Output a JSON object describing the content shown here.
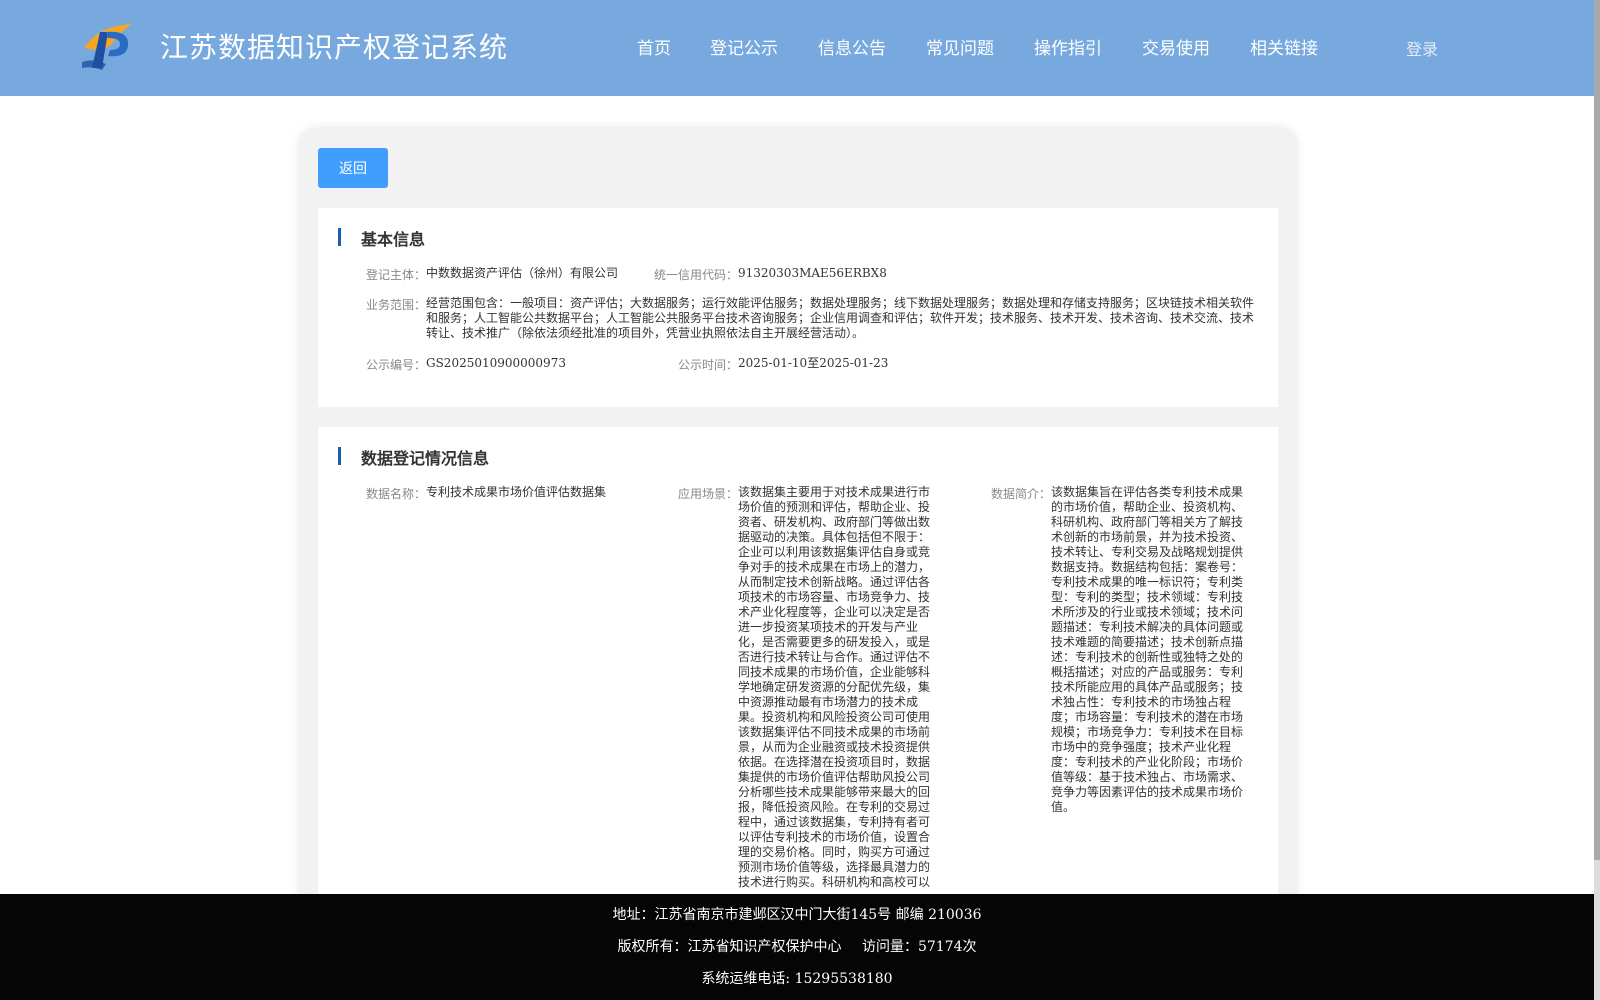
{
  "header": {
    "site_title": "江苏数据知识产权登记系统",
    "nav": [
      "首页",
      "登记公示",
      "信息公告",
      "常见问题",
      "操作指引",
      "交易使用",
      "相关链接"
    ],
    "login_label": "登录",
    "colors": {
      "header_bg": "#78a9de",
      "accent": "#409eff",
      "section_bar": "#1b5ea8"
    }
  },
  "back_label": "返回",
  "basic_info": {
    "title": "基本信息",
    "subject_label": "登记主体：",
    "subject_value": "中数数据资产评估（徐州）有限公司",
    "credit_label": "统一信用代码：",
    "credit_value": "91320303MAE56ERBX8",
    "scope_label": "业务范围：",
    "scope_value": "经营范围包含：一般项目：资产评估；大数据服务；运行效能评估服务；数据处理服务；线下数据处理服务；数据处理和存储支持服务；区块链技术相关软件和服务；人工智能公共数据平台；人工智能公共服务平台技术咨询服务；企业信用调查和评估；软件开发；技术服务、技术开发、技术咨询、技术交流、技术转让、技术推广（除依法须经批准的项目外，凭营业执照依法自主开展经营活动）。",
    "notice_no_label": "公示编号：",
    "notice_no_value": "GS2025010900000973",
    "notice_time_label": "公示时间：",
    "notice_time_value": "2025-01-10至2025-01-23"
  },
  "data_info": {
    "title": "数据登记情况信息",
    "name_label": "数据名称：",
    "name_value": "专利技术成果市场价值评估数据集",
    "scenario_label": "应用场景：",
    "scenario_value": "该数据集主要用于对技术成果进行市场价值的预测和评估，帮助企业、投资者、研发机构、政府部门等做出数据驱动的决策。具体包括但不限于：企业可以利用该数据集评估自身或竞争对手的技术成果在市场上的潜力，从而制定技术创新战略。通过评估各项技术的市场容量、市场竞争力、技术产业化程度等，企业可以决定是否进一步投资某项技术的开发与产业化，是否需要更多的研发投入，或是否进行技术转让与合作。通过评估不同技术成果的市场价值，企业能够科学地确定研发资源的分配优先级，集中资源推动最有市场潜力的技术成果。投资机构和风险投资公司可使用该数据集评估不同技术成果的市场前景，从而为企业融资或技术投资提供依据。在选择潜在投资项目时，数据集提供的市场价值评估帮助风投公司分析哪些技术成果能够带来最大的回报，降低投资风险。在专利的交易过程中，通过该数据集，专利持有者可以评估专利技术的市场价值，设置合理的交易价格。同时，购买方可通过预测市场价值等级，选择最具潜力的技术进行购买。科研机构和高校可以",
    "intro_label": "数据简介：",
    "intro_value": "该数据集旨在评估各类专利技术成果的市场价值，帮助企业、投资机构、科研机构、政府部门等相关方了解技术创新的市场前景，并为技术投资、技术转让、专利交易及战略规划提供数据支持。数据结构包括：案卷号：专利技术成果的唯一标识符；专利类型：专利的类型；技术领域：专利技术所涉及的行业或技术领域；技术问题描述：专利技术解决的具体问题或技术难题的简要描述；技术创新点描述：专利技术的创新性或独特之处的概括描述；对应的产品或服务：专利技术所能应用的具体产品或服务；技术独占性：专利技术的市场独占程度；市场容量：专利技术的潜在市场规模；市场竞争力：专利技术在目标市场中的竞争强度；技术产业化程度：专利技术的产业化阶段；市场价值等级：基于技术独占、市场需求、竞争力等因素评估的技术成果市场价值。"
  },
  "footer": {
    "address": "地址：江苏省南京市建邺区汉中门大街145号 邮编 210036",
    "copyright": "版权所有：江苏省知识产权保护中心",
    "visits": "访问量：57174次",
    "phone": "系统运维电话: 15295538180"
  }
}
